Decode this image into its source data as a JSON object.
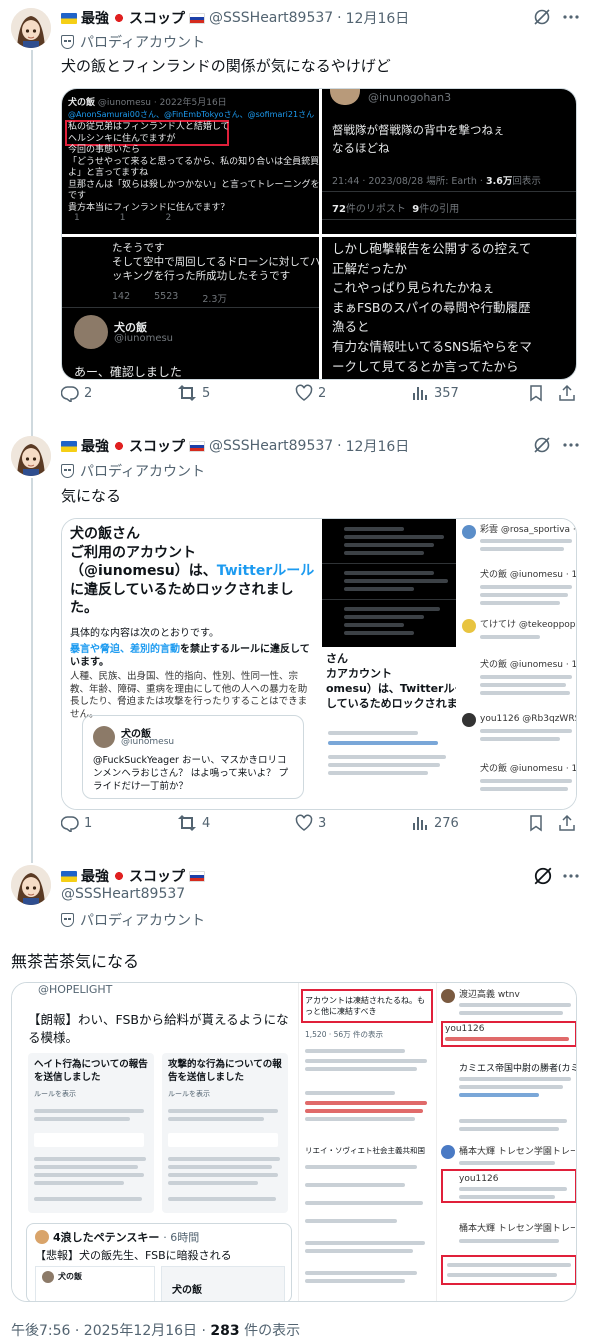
{
  "account": {
    "display_name": "最強",
    "display_name_suffix": "スコップ",
    "handle": "@SSSHeart89537",
    "parody_label": "パロディアカウント"
  },
  "tweets": [
    {
      "date": "12月16日",
      "text": "犬の飯とフィンランドの関係が気になるやけげど",
      "actions": {
        "replies": "2",
        "retweets": "5",
        "likes": "2",
        "views": "357"
      },
      "media": {
        "left_top": {
          "author": "犬の飯",
          "handle_date": "@iunomesu · 2022年5月16日",
          "reply_to": "@AnonSamurai00さん、@FinEmbTokyoさん、@sofimari21さん",
          "lines": [
            "私の従兄弟はフィンランド人と結婚して",
            "ヘルシンキに住んでますが",
            "今回の事態いたら",
            "「どうせやって来ると思ってるから、私の知り合いは全員銃買って構え",
            "よ」と言ってますね",
            "旦那さんは「奴らは殺しかつかない」と言ってトレーニングを開始した",
            "です",
            "貴方本当にフィンランドに住んでます？"
          ],
          "counts": [
            "1",
            "1",
            "2"
          ]
        },
        "right_top": {
          "handle": "@inunogohan3",
          "lines": [
            "督戦隊が督戦隊の背中を撃つねぇ",
            "なるほどね"
          ],
          "meta": "21:44 · 2023/08/28 場所: Earth ·",
          "views": "3.6万",
          "views_label": "回表示",
          "reposts": "72",
          "reposts_label": "件のリポスト",
          "quotes": "9",
          "quotes_label": "件の引用"
        },
        "left_bottom": {
          "lines": [
            "たそうです",
            "そして空中で周回してるドローンに対してハ",
            "ッキングを行った所成功したそうです"
          ],
          "counts": [
            "142",
            "5523",
            "2.3万"
          ],
          "author": "犬の飯",
          "handle": "@iunomesu",
          "body": "あー、確認しました"
        },
        "right_bottom": {
          "lines": [
            "しかし砲撃報告を公開するの控えて",
            "正解だったか",
            "これやっぱり見られたかねぇ",
            "まぁFSBのスパイの尋問や行動履歴",
            "漁ると",
            "有力な情報吐いてるSNS垢やらをマ",
            "ークして見てるとか言ってたから"
          ]
        }
      }
    },
    {
      "date": "12月16日",
      "text": "気になる",
      "actions": {
        "replies": "1",
        "retweets": "4",
        "likes": "3",
        "views": "276"
      },
      "media": {
        "left": {
          "title_lines": [
            "犬の飯さん",
            "ご利用のアカウント",
            "（@iunomesu）は、",
            "Twitterルール",
            "に違反しているためロックされまし",
            "た。"
          ],
          "detail": "具体的な内容は次のとおりです。",
          "violation": "暴言や脅迫、差別的言動",
          "violation_suffix": "を禁止するルールに違反しています。",
          "description": "人種、民族、出身国、性的指向、性別、性同一性、宗教、年齢、障碍、重病を理由にして他の人への暴力を助長したり、脅迫または攻撃を行ったりすることはできません。",
          "quoted_author": "犬の飯",
          "quoted_handle": "@iunomesu",
          "quoted_text": "@FuckSuckYeager おーい、マスかきロリコンメンヘラおじさん？ はよ鳴って来いよ？ プライドだけ一丁前か？"
        },
        "middle": {
          "lines": [
            "さん",
            "カアカウント",
            "omesu）は、Twitterルール",
            "しているためロックされまし"
          ]
        },
        "right": {
          "user1": "彩雲 @rosa_sportiva · 10h",
          "user2": "てけてけ @tekeoppopsu · 11h",
          "user3": "you1126 @Rb3qzWRSAKSnoqk",
          "reply_name": "犬の飯 @iunomesu · 11h"
        }
      }
    },
    {
      "date": "",
      "text": "無茶苦茶気になる",
      "timestamp": "午後7:56 · 2025年12月16日 ·",
      "views_count": "283",
      "views_label": "件の表示",
      "media": {
        "left": {
          "top_handle": "@HOPELIGHT",
          "announcement": "【朗報】わい、FSBから給料が貰えるようになる模様。",
          "card_left_title": "ヘイト行為についての報告を送信しました",
          "card_right_title": "攻撃的な行為についての報告を送信しました",
          "card_sub": "ルールを表示",
          "quote_header": "4浪したペテンスキー",
          "quote_time": "6時間",
          "quote_text": "【悲報】犬の飯先生、FSBに暗殺される",
          "bottom_name": "犬の飯"
        },
        "middle": {
          "header": "アカウントは凍結されたるね。もっと他に凍結すべき",
          "stats": "1,520 · 56万 件の表示",
          "section": "リエイ・ソヴィエト社会主義共和国"
        },
        "right": {
          "header": "渡辺高義 wtnv",
          "quote_user": "you1126",
          "warning": "カミエス帝国中尉の勝者(カミ生)",
          "reply1": "桶本大輝 トレセン学園トレーナー兼ハンター",
          "reply2": "you1126"
        }
      }
    }
  ],
  "icons": [
    "verified-off-icon",
    "more-icon",
    "reply-icon",
    "retweet-icon",
    "like-icon",
    "views-icon",
    "bookmark-icon",
    "share-icon"
  ],
  "colors": {
    "accent": "#1d9bf0",
    "text": "#0f1419",
    "secondary": "#536471",
    "border": "#cfd9de",
    "red": "#e0203a"
  }
}
